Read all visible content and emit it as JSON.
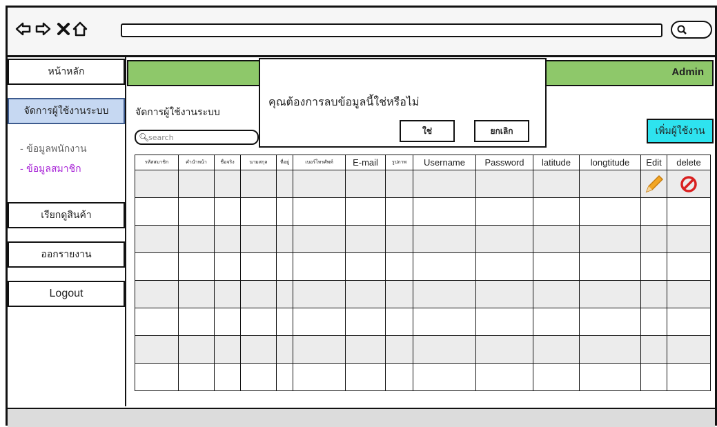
{
  "browser": {
    "back_icon": "arrow-left-icon",
    "forward_icon": "arrow-right-icon",
    "close_icon": "x-icon",
    "home_icon": "home-icon",
    "search_icon": "magnifier-icon"
  },
  "sidebar": {
    "home": "หน้าหลัก",
    "manage_users": "จัดการผู้ใช้งานระบบ",
    "sub_employee": "- ข้อมูลพนักงาน",
    "sub_member": "- ข้อมูลสมาชิก",
    "view_products": "เรียกดูสินค้า",
    "reports": "ออกรายงาน",
    "logout": "Logout"
  },
  "header": {
    "user": "Admin",
    "bar_color": "#8ec86a"
  },
  "main": {
    "title": "จัดการผู้ใช้งานระบบ",
    "search_placeholder": "search",
    "add_button": "เพิ่มผู้ใช้งาน",
    "columns": [
      "รหัสสมาชิก",
      "คำนำหน้า",
      "ชื่อจริง",
      "นามสกุล",
      "ที่อยู่",
      "เบอร์โทรศัพท์",
      "E-mail",
      "รูปภาพ",
      "Username",
      "Password",
      "latitude",
      "longtitude",
      "Edit",
      "delete"
    ],
    "row_count": 8,
    "edit_icon": "pencil-icon",
    "delete_icon": "prohibited-icon"
  },
  "dialog": {
    "message": "คุณต้องการลบข้อมูลนี้ใช่หรือไม่",
    "confirm": "ใช่",
    "cancel": "ยกเลิก"
  },
  "colors": {
    "accent_button": "#2ee3ef",
    "active_menu": "#c6d8f2",
    "active_sub": "#a61fd6"
  }
}
